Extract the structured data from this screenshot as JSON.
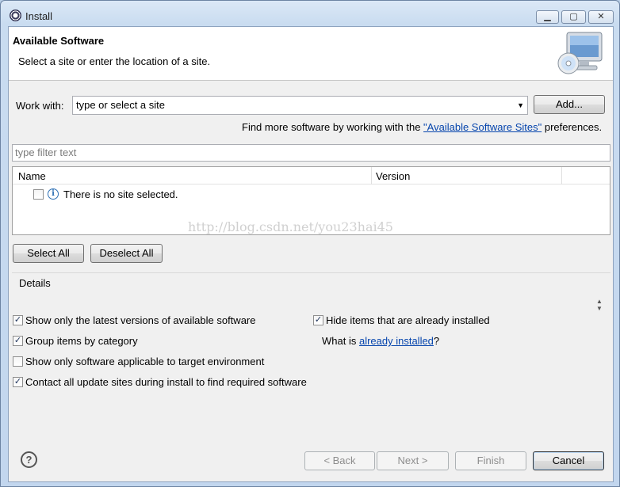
{
  "window": {
    "title": "Install",
    "minimize_glyph": "▁",
    "maximize_glyph": "▢",
    "close_glyph": "✕"
  },
  "banner": {
    "title": "Available Software",
    "description": "Select a site or enter the location of a site.",
    "icon": "monitor-cd-icon"
  },
  "work_with": {
    "label": "Work with:",
    "value": "type or select a site",
    "add_button": "Add...",
    "hint_prefix": "Find more software by working with the ",
    "hint_link": "\"Available Software Sites\"",
    "hint_suffix": " preferences."
  },
  "filter": {
    "placeholder": "type filter text"
  },
  "table": {
    "columns": [
      "Name",
      "Version"
    ],
    "rows": [
      {
        "checked": false,
        "icon": "info-icon",
        "text": "There is no site selected."
      }
    ]
  },
  "selection": {
    "select_all": "Select All",
    "deselect_all": "Deselect All"
  },
  "watermark": "http://blog.csdn.net/you23hai45",
  "details": {
    "label": "Details"
  },
  "options": {
    "latest_versions": {
      "label": "Show only the latest versions of available software",
      "checked": true
    },
    "group_by_category": {
      "label": "Group items by category",
      "checked": true
    },
    "target_env": {
      "label": "Show only software applicable to target environment",
      "checked": false
    },
    "contact_sites": {
      "label": "Contact all update sites during install to find required software",
      "checked": true
    },
    "hide_installed": {
      "label": "Hide items that are already installed",
      "checked": true
    },
    "what_is_prefix": "What is ",
    "what_is_link": "already installed",
    "what_is_suffix": "?"
  },
  "footer": {
    "help_glyph": "?",
    "back": "< Back",
    "next": "Next >",
    "finish": "Finish",
    "cancel": "Cancel"
  },
  "colors": {
    "link": "#0645ad",
    "titlebar": "#c9dcf0",
    "dialog_bg": "#f0f0f0"
  }
}
